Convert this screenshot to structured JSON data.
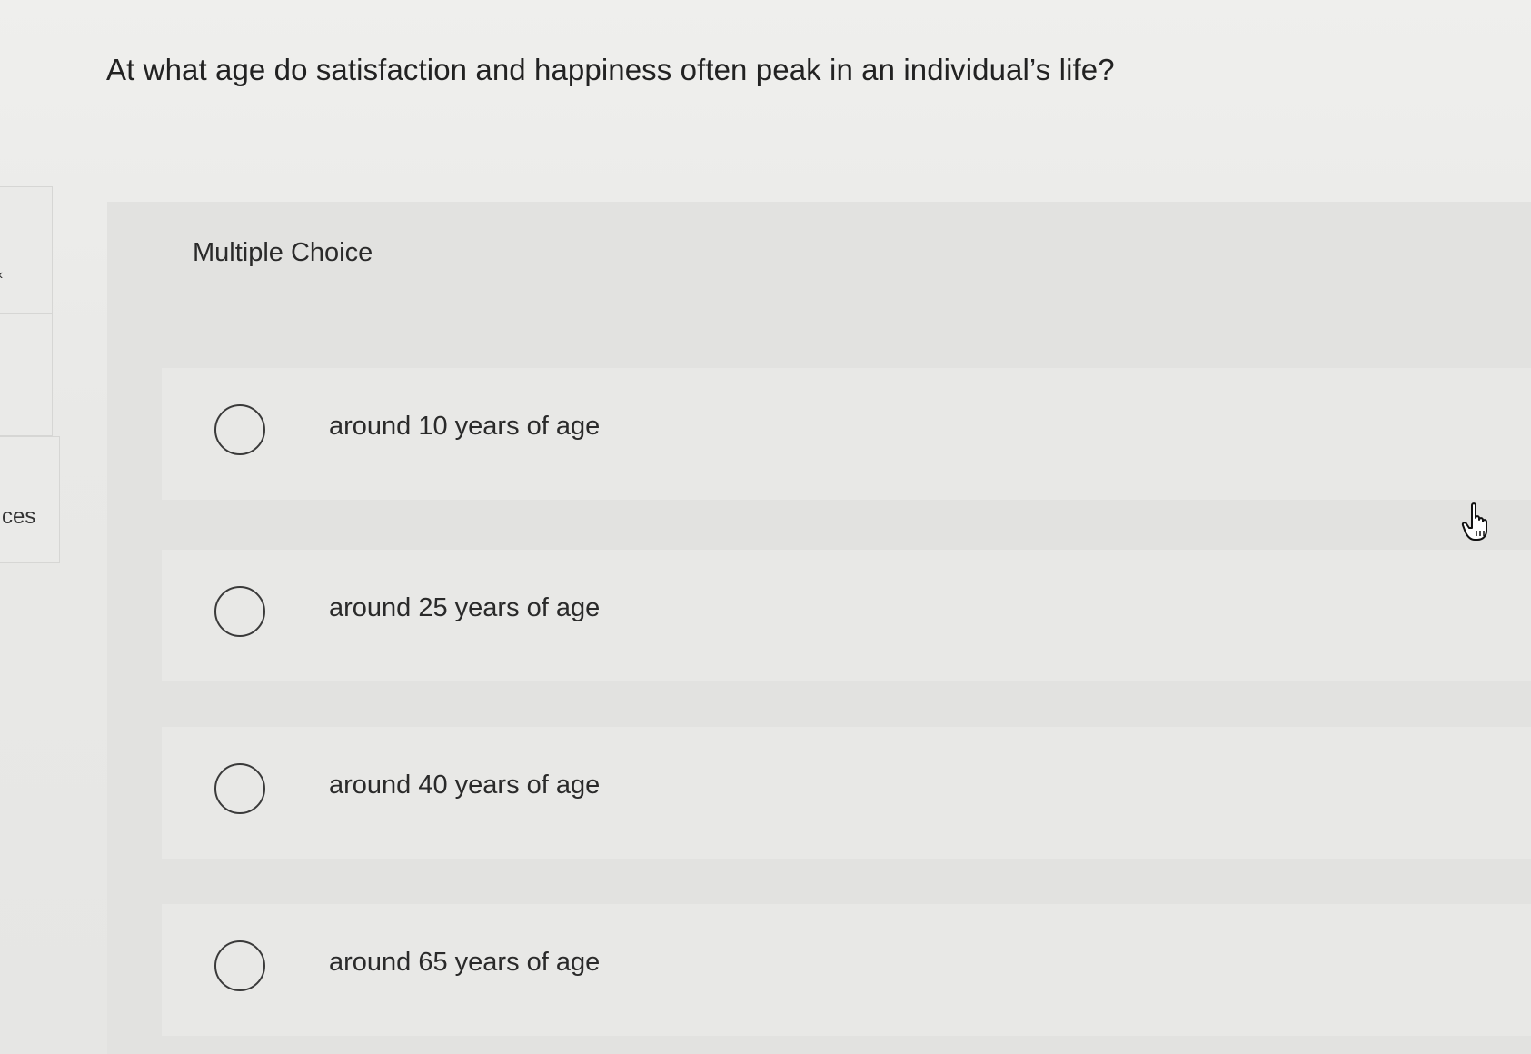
{
  "question": {
    "text": "At what age do satisfaction and happiness often peak in an individual’s life?"
  },
  "sidebar": {
    "chevron": "‹",
    "partial_label": "ces"
  },
  "panel": {
    "type_label": "Multiple Choice",
    "options": [
      {
        "label": "around 10 years of age",
        "selected": false
      },
      {
        "label": "around 25 years of age",
        "selected": false
      },
      {
        "label": "around 40 years of age",
        "selected": false
      },
      {
        "label": "around 65 years of age",
        "selected": false
      }
    ]
  },
  "icons": {
    "radio": "radio-empty-icon",
    "cursor": "hand-pointer-icon"
  },
  "colors": {
    "background": "#ececea",
    "panel": "#e2e2e0",
    "text": "#2a2a2a"
  }
}
